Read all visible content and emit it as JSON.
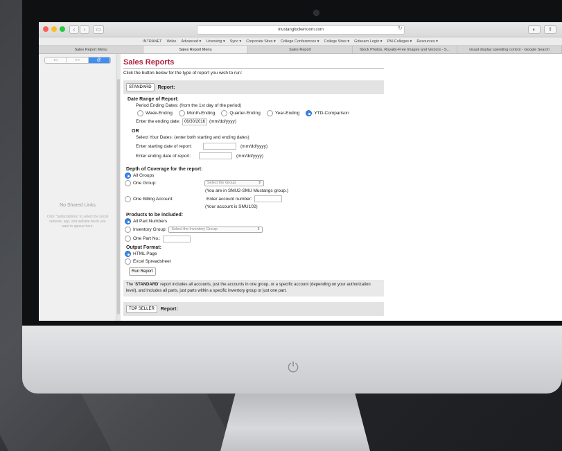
{
  "browser": {
    "url": "mustanglockerroom.com",
    "bookmarks": [
      "INTRANET",
      "Wrike",
      "Advanced ▾",
      "Licensing ▾",
      "Sync ▾",
      "Corporate Sites ▾",
      "College Conferences ▾",
      "College Sites ▾",
      "Gdsearn Login ▾",
      "PM-Colleges ▾",
      "Resources ▾"
    ],
    "tabs": [
      "Sales Report Menu",
      "Sales Report Menu",
      "Sales Report",
      "Stock Photos, Royalty-Free Images and Vectors - S...",
      "visual display spending control - Google Search"
    ]
  },
  "sidebar": {
    "title": "No Shared Links",
    "description": "Click \"Subscriptions\" to select the social network, app, and website feeds you want to appear here."
  },
  "page": {
    "title": "Sales Reports",
    "intro": "Click the button below for the type of report you wish to run:",
    "standard_button": "STANDARD",
    "report_label": "Report:",
    "date_range": {
      "heading": "Date Range of Report:",
      "period_text": "Period Ending Dates: (from the 1st day of the period)",
      "options": [
        "Week-Ending",
        "Month-Ending",
        "Quarter-Ending",
        "Year-Ending",
        "YTD-Comparison"
      ],
      "selected_option": "YTD-Comparison",
      "ending_label": "Enter the ending date:",
      "ending_value": "06/30/2016",
      "ending_format": "(mm/dd/yyyy)",
      "or_label": "OR",
      "select_dates_text": "Select Your Dates: (enter both starting and ending dates)",
      "start_label": "Enter starting date of report:",
      "start_value": "",
      "start_format": "(mm/dd/yyyy)",
      "end_label": "Enter ending date of report:",
      "end_value": "",
      "end_format": "(mm/dd/yyyy)"
    },
    "depth": {
      "heading": "Depth of Coverage for the report:",
      "all_groups": "All Groups",
      "one_group": "One Group:",
      "group_select": "Select the Group",
      "group_note": "(You are in SMU2-SMU Mustangs group.)",
      "one_billing": "One Billing Account:",
      "account_label": "Enter account number:",
      "account_value": "",
      "account_note": "(Your account is SMU102)"
    },
    "products": {
      "heading": "Products to be included:",
      "all_parts": "All Part Numbers",
      "inventory_group": "Inventory Group:",
      "inventory_select": "Select the Inventory Group:",
      "one_part": "One Part No.:",
      "part_value": ""
    },
    "output": {
      "heading": "Output Format:",
      "html": "HTML Page",
      "excel": "Excel Spreadsheet",
      "run_button": "Run Report"
    },
    "note_prefix": "The '",
    "note_bold": "STANDARD",
    "note_text": "' report includes all accounts, just the accounts in one group, or a specific account (depending on your authorization level), and includes all parts, just parts within a specific inventory group or just one part.",
    "next_button": "TOP SELLER",
    "next_label": "Report:"
  },
  "colors": {
    "title": "#b01e3c",
    "radio_selected": "#3b86ea",
    "sidebar_toggle": "#3f8ef2"
  }
}
